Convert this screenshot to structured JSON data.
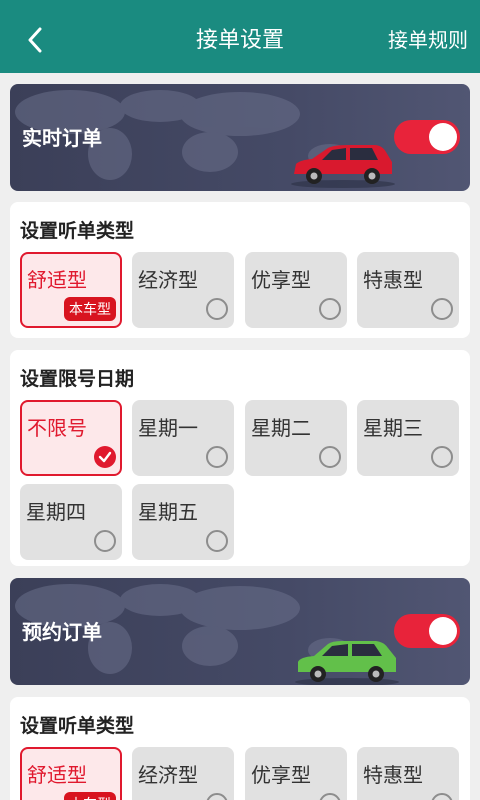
{
  "header": {
    "title": "接单设置",
    "rules_label": "接单规则",
    "back_icon": "chevron-left-icon"
  },
  "colors": {
    "header_bg": "#1a8b80",
    "accent": "#e0192e",
    "banner_bg": "#454a66"
  },
  "realtime": {
    "label": "实时订单",
    "toggle_on": true,
    "car_icon": "red-car-icon",
    "type_section": {
      "heading": "设置听单类型",
      "options": [
        {
          "label": "舒适型",
          "selected": true,
          "badge": "本车型"
        },
        {
          "label": "经济型",
          "selected": false
        },
        {
          "label": "优享型",
          "selected": false
        },
        {
          "label": "特惠型",
          "selected": false
        }
      ]
    },
    "restriction_section": {
      "heading": "设置限号日期",
      "options": [
        {
          "label": "不限号",
          "selected": true
        },
        {
          "label": "星期一",
          "selected": false
        },
        {
          "label": "星期二",
          "selected": false
        },
        {
          "label": "星期三",
          "selected": false
        },
        {
          "label": "星期四",
          "selected": false
        },
        {
          "label": "星期五",
          "selected": false
        }
      ]
    }
  },
  "reserved": {
    "label": "预约订单",
    "toggle_on": true,
    "car_icon": "green-car-icon",
    "type_section": {
      "heading": "设置听单类型",
      "options": [
        {
          "label": "舒适型",
          "selected": true,
          "badge": "本车型"
        },
        {
          "label": "经济型",
          "selected": false
        },
        {
          "label": "优享型",
          "selected": false
        },
        {
          "label": "特惠型",
          "selected": false
        }
      ]
    }
  }
}
